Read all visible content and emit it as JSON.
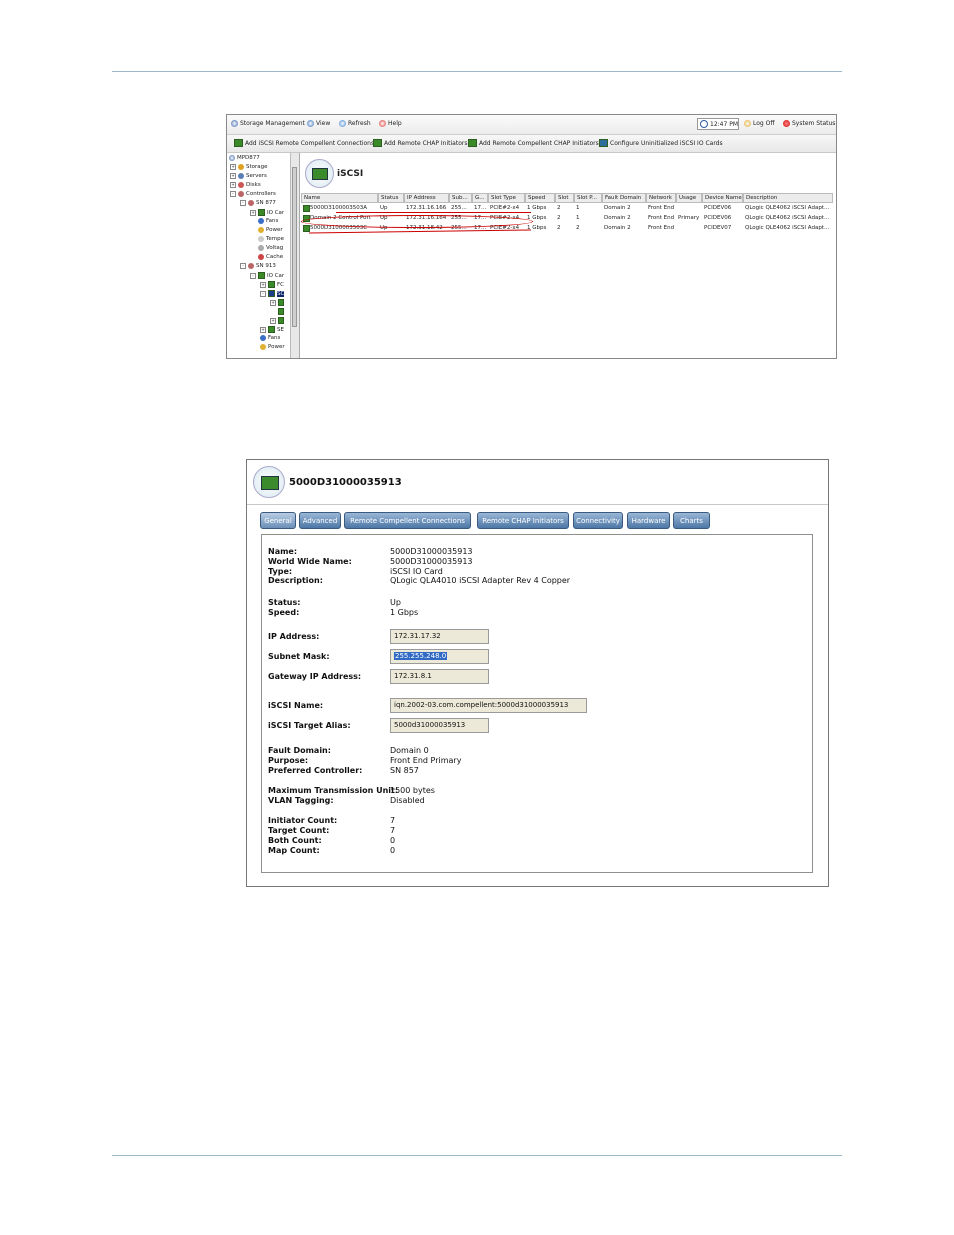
{
  "screenshot1": {
    "menubar": {
      "storage_management": "Storage Management",
      "view": "View",
      "refresh": "Refresh",
      "help": "Help",
      "time": "12:47 PM",
      "log_off": "Log Off",
      "system_status": "System Status"
    },
    "toolbar": {
      "add_iscsi_remote": "Add iSCSI Remote Compellent Connections",
      "add_remote_chap": "Add Remote CHAP Initiators",
      "add_remote_compellent_chap": "Add Remote Compellent CHAP Initiators",
      "configure_uninitialized": "Configure Uninitialized iSCSI IO Cards"
    },
    "tree": {
      "root": "MPD877",
      "storage": "Storage",
      "servers": "Servers",
      "disks": "Disks",
      "controllers": "Controllers",
      "sn877": "SN 877",
      "io_cards_1": "IO Car",
      "fans_1": "Fans",
      "power_1": "Power",
      "temp": "Tempe",
      "voltage": "Voltag",
      "cache": "Cache",
      "sn913": "SN 913",
      "io_cards_2": "IO Car",
      "fc": "FC",
      "sc": "SC",
      "se": "SE",
      "fans_2": "Fans",
      "power_2": "Power"
    },
    "title": "iSCSI",
    "columns": [
      "Name",
      "Status",
      "IP Address",
      "Sub...",
      "G...",
      "Slot Type",
      "Speed",
      "Slot",
      "Slot P...",
      "Fault Domain",
      "Network",
      "Usage",
      "Device Name",
      "Description"
    ],
    "rows": [
      [
        "5000D3100003503A",
        "Up",
        "172.31.16.166",
        "255...",
        "17...",
        "PCIE#2-x4",
        "1 Gbps",
        "2",
        "1",
        "Domain 2",
        "Front End",
        "",
        "PCIDEV06",
        "QLogic QLE4062 iSCSI Adapt..."
      ],
      [
        "Domain 2 Control Port",
        "Up",
        "172.31.16.164",
        "255...",
        "17...",
        "PCIE#2-x4",
        "1 Gbps",
        "2",
        "1",
        "Domain 2",
        "Front End",
        "Primary",
        "PCIDEV06",
        "QLogic QLE4062 iSCSI Adapt..."
      ],
      [
        "5000D3100003503C",
        "Up",
        "172.31.18.42",
        "255...",
        "17...",
        "PCIE#2-x4",
        "1 Gbps",
        "2",
        "2",
        "Domain 2",
        "Front End",
        "",
        "PCIDEV07",
        "QLogic QLE4062 iSCSI Adapt..."
      ]
    ]
  },
  "screenshot2": {
    "title": "5000D31000035913",
    "tabs": [
      "General",
      "Advanced",
      "Remote Compellent Connections",
      "Remote CHAP Initiators",
      "Connectivity",
      "Hardware",
      "Charts"
    ],
    "labels": {
      "name": "Name:",
      "wwn": "World Wide Name:",
      "type": "Type:",
      "description": "Description:",
      "status": "Status:",
      "speed": "Speed:",
      "ip": "IP Address:",
      "subnet": "Subnet Mask:",
      "gateway": "Gateway IP Address:",
      "iscsi_name": "iSCSI Name:",
      "iscsi_alias": "iSCSI Target Alias:",
      "fault_domain": "Fault Domain:",
      "purpose": "Purpose:",
      "preferred_controller": "Preferred Controller:",
      "mtu": "Maximum Transmission Unit:",
      "vlan": "VLAN Tagging:",
      "initiator_count": "Initiator Count:",
      "target_count": "Target Count:",
      "both_count": "Both Count:",
      "map_count": "Map Count:"
    },
    "values": {
      "name": "5000D31000035913",
      "wwn": "5000D31000035913",
      "type": "iSCSI IO Card",
      "description": "QLogic QLA4010 iSCSI Adapter Rev 4 Copper",
      "status": "Up",
      "speed": "1 Gbps",
      "ip": "172.31.17.32",
      "subnet": "255.255.248.0",
      "gateway": "172.31.8.1",
      "iscsi_name": "iqn.2002-03.com.compellent:5000d31000035913",
      "iscsi_alias": "5000d31000035913",
      "fault_domain": "Domain 0",
      "purpose": "Front End Primary",
      "preferred_controller": "SN 857",
      "mtu": "1500 bytes",
      "vlan": "Disabled",
      "initiator_count": "7",
      "target_count": "7",
      "both_count": "0",
      "map_count": "0"
    }
  }
}
